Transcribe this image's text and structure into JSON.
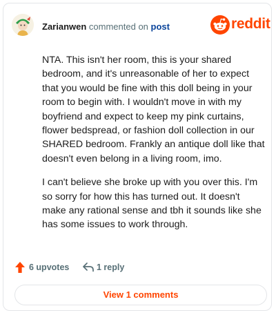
{
  "header": {
    "username": "Zarianwen",
    "action_text": "commented on",
    "post_link": "post",
    "brand": "reddit"
  },
  "comment": {
    "paragraphs": [
      "NTA. This isn't her room, this is your shared bedroom, and it's unreasonable of her to expect that you would be fine with this doll being in your room to begin with. I wouldn't move in with my boyfriend and expect to keep my pink curtains, flower bedspread, or fashion doll collection in our SHARED bedroom. Frankly an antique doll like that doesn't even belong in a living room, imo.",
      "I can't believe she broke up with you over this. I'm so sorry for how this has turned out. It doesn't make any rational sense and tbh it sounds like she has some issues to work through."
    ]
  },
  "actions": {
    "upvotes_label": "6 upvotes",
    "reply_label": "1 reply",
    "view_comments_label": "View 1 comments"
  },
  "colors": {
    "brand": "#ff4500",
    "link": "#0a449b",
    "muted": "#576f76",
    "text": "#1c1c1c",
    "border": "#e3e5e8"
  },
  "icons": {
    "avatar": "user-avatar",
    "logo": "reddit-alien-icon",
    "upvote": "upvote-arrow-icon",
    "reply": "reply-arrow-icon"
  }
}
